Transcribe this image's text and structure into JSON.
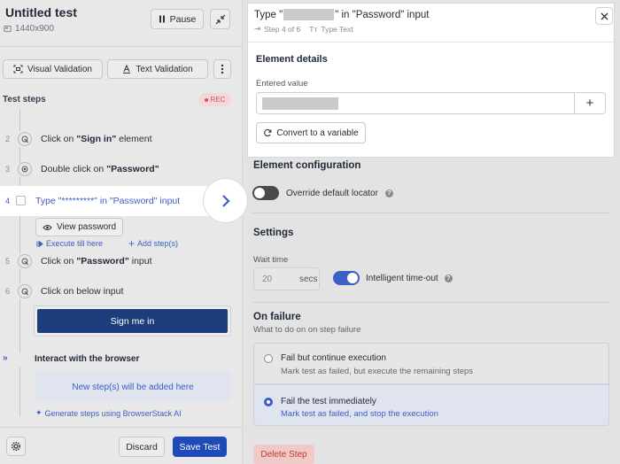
{
  "header": {
    "title": "Untitled test",
    "resolution": "1440x900",
    "pause_label": "Pause"
  },
  "validation": {
    "visual_label": "Visual Validation",
    "text_label": "Text Validation"
  },
  "steps_header": {
    "title": "Test steps",
    "rec_badge": "REC"
  },
  "steps": [
    {
      "num": "2",
      "prefix": "Click on ",
      "bold": "\"Sign in\"",
      "suffix": " element"
    },
    {
      "num": "3",
      "prefix": "Double click on ",
      "bold": "\"Password\"",
      "suffix": ""
    },
    {
      "num": "4",
      "text": "Type \"*********\" in \"Password\" input"
    },
    {
      "num": "5",
      "prefix": "Click on ",
      "bold": "\"Password\"",
      "suffix": " input"
    },
    {
      "num": "6",
      "prefix": "Click on below input",
      "bold": "",
      "suffix": ""
    }
  ],
  "active_step": {
    "view_password": "View password",
    "execute_till": "Execute till here",
    "add_step": "Add step(s)"
  },
  "sign_me_in": "Sign me in",
  "interact": {
    "label": "Interact with the browser",
    "placeholder": "New step(s) will be added here",
    "ai_link": "Generate steps using BrowserStack AI"
  },
  "footer": {
    "discard": "Discard",
    "save": "Save Test"
  },
  "modal": {
    "title_prefix": "Type \"",
    "title_suffix": "\" in \"Password\" input",
    "step_meta": "Step 4 of 6",
    "type_meta": "Type Text",
    "section": "Element details",
    "entered_label": "Entered value",
    "convert": "Convert to a variable"
  },
  "config": {
    "title": "Element configuration",
    "override": "Override default locator"
  },
  "settings": {
    "title": "Settings",
    "wait_label": "Wait time",
    "wait_value": "20",
    "wait_unit": "secs",
    "intelligent": "Intelligent time-out"
  },
  "failure": {
    "title": "On failure",
    "subtitle": "What to do on on step failure",
    "opt1_title": "Fail but continue execution",
    "opt1_desc": "Mark test as failed, but execute the remaining steps",
    "opt2_title": "Fail the test immediately",
    "opt2_desc": "Mark test as failed, and stop the execution",
    "delete": "Delete Step"
  },
  "colors": {
    "accent": "#3b5fc4",
    "primary_btn": "#1e4bb8",
    "dark_blue": "#1c3d7a",
    "rec": "#d9534f",
    "delete_bg": "#f0c9c9",
    "delete_text": "#c0392b"
  }
}
